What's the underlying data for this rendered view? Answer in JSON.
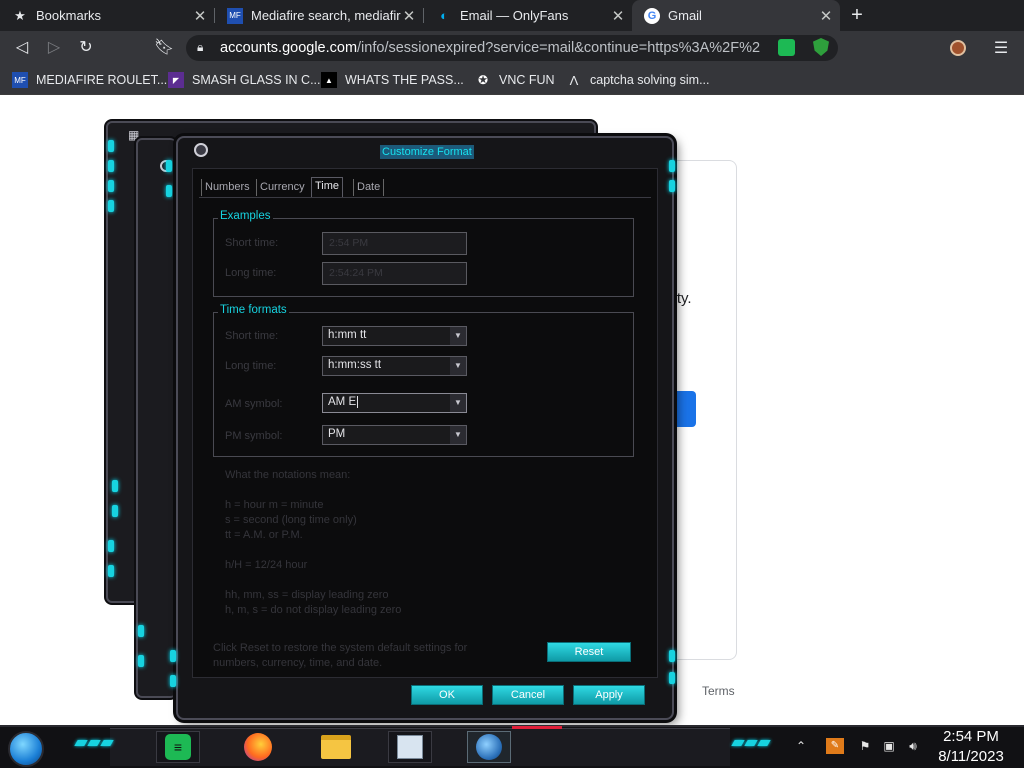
{
  "browser": {
    "tabs": [
      {
        "title": "Bookmarks",
        "icon": "star-icon"
      },
      {
        "title": "Mediafire search, mediafire s",
        "icon": "mediafire-favicon"
      },
      {
        "title": "Email — OnlyFans",
        "icon": "onlyfans-favicon"
      },
      {
        "title": "Gmail",
        "icon": "google-favicon"
      }
    ],
    "new_tab": "+",
    "url_host": "accounts.google.com",
    "url_path": "/info/sessionexpired?service=mail&continue=https%3A%2F%2F...",
    "bookmarks": [
      {
        "label": "MEDIAFIRE ROULET...",
        "icon": "mediafire-favicon"
      },
      {
        "label": "SMASH GLASS IN C...",
        "icon": "visual-studio-icon"
      },
      {
        "label": "WHATS THE PASS...",
        "icon": "terminal-icon"
      },
      {
        "label": "VNC FUN",
        "icon": "vnc-icon"
      },
      {
        "label": "captcha solving sim...",
        "icon": "arch-icon"
      }
    ]
  },
  "page": {
    "text_fragment": "vity.",
    "terms": "Terms"
  },
  "dialog": {
    "title": "Customize Format",
    "tabs": [
      "Numbers",
      "Currency",
      "Time",
      "Date"
    ],
    "active_tab": "Time",
    "examples": {
      "group_title": "Examples",
      "short_label": "Short time:",
      "short_value": "2:54 PM",
      "long_label": "Long time:",
      "long_value": "2:54:24 PM"
    },
    "formats": {
      "group_title": "Time formats",
      "short_label": "Short time:",
      "short_value": "h:mm tt",
      "long_label": "Long time:",
      "long_value": "h:mm:ss tt",
      "am_label": "AM symbol:",
      "am_value": "AM E",
      "pm_label": "PM symbol:",
      "pm_value": "PM"
    },
    "help": {
      "heading": "What the notations mean:",
      "lines": [
        "h = hour   m = minute",
        "s = second (long time only)",
        "tt = A.M. or P.M.",
        "h/H = 12/24 hour",
        "hh, mm, ss = display leading zero",
        "h, m, s = do not display leading zero"
      ],
      "reset_note": "Click Reset to restore the system default settings for numbers, currency, time, and date."
    },
    "buttons": {
      "reset": "Reset",
      "ok": "OK",
      "cancel": "Cancel",
      "apply": "Apply"
    }
  },
  "taskbar": {
    "time": "2:54 PM",
    "date": "8/11/2023",
    "apps": [
      "spotify-icon",
      "firefox-icon",
      "file-explorer-icon",
      "calendar-clock-icon",
      "region-globe-icon"
    ]
  },
  "colors": {
    "accent_cyan": "#17d3e0",
    "chrome_dark": "#35363a",
    "google_blue": "#1a73e8"
  }
}
